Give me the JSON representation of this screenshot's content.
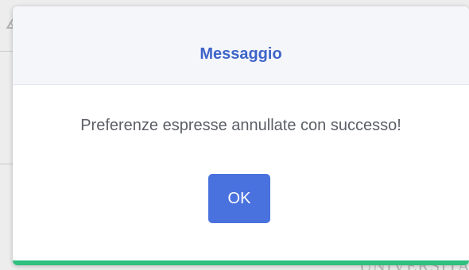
{
  "background": {
    "partial_text": "UNIVERSITA"
  },
  "dialog": {
    "title": "Messaggio",
    "message": "Preferenze espresse annullate con successo!",
    "ok_label": "OK"
  },
  "colors": {
    "title": "#3e63c9",
    "button": "#4a72de",
    "accent_bar": "#2fbf7f",
    "header_bg": "#f4f6fa",
    "message_text": "#5b5f66"
  }
}
